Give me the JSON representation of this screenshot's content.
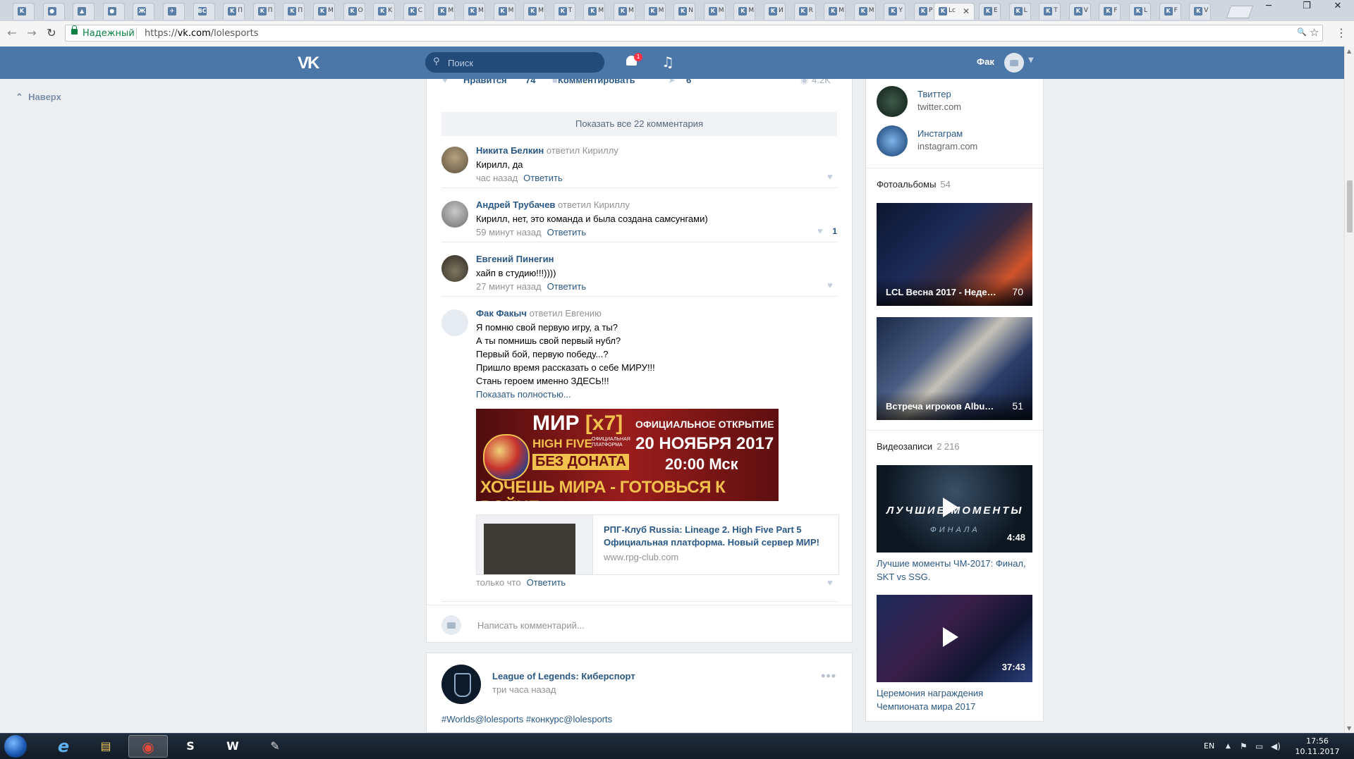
{
  "browser": {
    "tabs": [
      {
        "glyph": "K"
      },
      {
        "glyph": "●"
      },
      {
        "glyph": "▲"
      },
      {
        "glyph": "●"
      },
      {
        "glyph": "Ж"
      },
      {
        "glyph": "✈"
      },
      {
        "glyph": "BC"
      },
      {
        "glyph": "K",
        "label": "П"
      },
      {
        "glyph": "K",
        "label": "П"
      },
      {
        "glyph": "K",
        "label": "П"
      },
      {
        "glyph": "K",
        "label": "M"
      },
      {
        "glyph": "K",
        "label": "О"
      },
      {
        "glyph": "K",
        "label": "K"
      },
      {
        "glyph": "K",
        "label": "C"
      },
      {
        "glyph": "K",
        "label": "M"
      },
      {
        "glyph": "K",
        "label": "M"
      },
      {
        "glyph": "K",
        "label": "M"
      },
      {
        "glyph": "K",
        "label": "M"
      },
      {
        "glyph": "K",
        "label": "T"
      },
      {
        "glyph": "K",
        "label": "M"
      },
      {
        "glyph": "K",
        "label": "M"
      },
      {
        "glyph": "K",
        "label": "M"
      },
      {
        "glyph": "K",
        "label": "N"
      },
      {
        "glyph": "K",
        "label": "M"
      },
      {
        "glyph": "K",
        "label": "M"
      },
      {
        "glyph": "K",
        "label": "И"
      },
      {
        "glyph": "K",
        "label": "R"
      },
      {
        "glyph": "K",
        "label": "M"
      },
      {
        "glyph": "K",
        "label": "M"
      },
      {
        "glyph": "K",
        "label": "Y"
      },
      {
        "glyph": "K",
        "label": "P"
      }
    ],
    "active_tab": {
      "glyph": "K",
      "label": "Lc",
      "close": "✕"
    },
    "tabs_after": [
      {
        "glyph": "K",
        "label": "E"
      },
      {
        "glyph": "K",
        "label": "L"
      },
      {
        "glyph": "K",
        "label": "T"
      },
      {
        "glyph": "K",
        "label": "V"
      },
      {
        "glyph": "K",
        "label": "F"
      },
      {
        "glyph": "K",
        "label": "L"
      },
      {
        "glyph": "K",
        "label": "F"
      },
      {
        "glyph": "K",
        "label": "V"
      }
    ],
    "window_controls": {
      "minimize": "─",
      "restore": "❐",
      "close": "✕"
    },
    "nav": {
      "back": "←",
      "forward": "→",
      "reload": "↻"
    },
    "secure_label": "Надежный",
    "url_scheme": "https://",
    "url_host": "vk.com",
    "url_path": "/lolesports",
    "zoom_icon": "🔍",
    "star_icon": "☆",
    "menu_icon": "⋮"
  },
  "header": {
    "logo": "VK",
    "search_placeholder": "Поиск",
    "notifications_count": "1",
    "user_name": "Фак"
  },
  "left": {
    "back_to_top": "Наверх"
  },
  "post": {
    "actions": {
      "like_label": "Нравится",
      "like_count": "74",
      "comment_label": "Комментировать",
      "share_count": "6",
      "views": "4.2K"
    },
    "show_all_comments": "Показать все 22 комментария",
    "comments": [
      {
        "author": "Никита Белкин",
        "reply_to": "ответил Кириллу",
        "text": [
          "Кирилл, да"
        ],
        "time": "час назад",
        "reply": "Ответить",
        "likes": ""
      },
      {
        "author": "Андрей Трубачев",
        "reply_to": "ответил Кириллу",
        "text": [
          "Кирилл, нет, это команда и была создана самсунгами)"
        ],
        "time": "59 минут назад",
        "reply": "Ответить",
        "likes": "1"
      },
      {
        "author": "Евгений Пинегин",
        "reply_to": "",
        "text": [
          "хайп в студию!!!))))"
        ],
        "time": "27 минут назад",
        "reply": "Ответить",
        "likes": ""
      },
      {
        "author": "Фак Факыч",
        "reply_to": "ответил Евгению",
        "text": [
          "Я помню свой первую игру, а ты?",
          "А ты помнишь свой первый нубл?",
          "Первый бой, первую победу...?",
          "Пришло время рассказать о себе МИРУ!!!",
          "Стань героем именно ЗДЕСЬ!!!"
        ],
        "show_more": "Показать полностью...",
        "time": "только что",
        "reply": "Ответить",
        "likes": ""
      }
    ],
    "banner": {
      "line1": "МИР",
      "line1b": "[x7]",
      "line2": "ОФИЦИАЛЬНОЕ ОТКРЫТИЕ",
      "line3": "HIGH FIVE",
      "line3s": "ОФИЦИАЛЬНАЯ ПЛАТФОРМА",
      "line4": "20 НОЯБРЯ 2017",
      "line5": "БЕЗ ДОНАТА",
      "line6": "20:00 Мск",
      "line7": "ХОЧЕШЬ МИРА - ГОТОВЬСЯ К ВОЙНЕ"
    },
    "link": {
      "title": "РПГ-Клуб Russia: Lineage 2. High Five Part 5 Официальная платформа. Новый сервер МИР!",
      "domain": "www.rpg-club.com"
    },
    "write_placeholder": "Написать комментарий..."
  },
  "next_post": {
    "group": "League of Legends: Киберспорт",
    "time": "три часа назад",
    "tags": "#Worlds@lolesports #конкурс@lolesports",
    "menu": "•••"
  },
  "right": {
    "links": [
      {
        "name": "Твиттер",
        "domain": "twitter.com"
      },
      {
        "name": "Инстаграм",
        "domain": "instagram.com"
      }
    ],
    "albums_label": "Фотоальбомы",
    "albums_count": "54",
    "albums": [
      {
        "title": "LCL Весна 2017 - Недел...",
        "count": "70"
      },
      {
        "title": "Встреча игроков Albus N...",
        "count": "51"
      }
    ],
    "videos_label": "Видеозаписи",
    "videos_count": "2 216",
    "videos": [
      {
        "title": "Лучшие моменты ЧМ-2017: Финал, SKT vs SSG.",
        "duration": "4:48",
        "overlay1": "ЛУЧШИЕ МОМЕНТЫ",
        "overlay2": "ФИНАЛА"
      },
      {
        "title": "Церемония награждения Чемпионата мира 2017",
        "duration": "37:43"
      }
    ]
  },
  "taskbar": {
    "apps": [
      {
        "name": "ie",
        "glyph": "e"
      },
      {
        "name": "explorer",
        "glyph": "▤"
      },
      {
        "name": "chrome",
        "glyph": "◉"
      },
      {
        "name": "skype",
        "glyph": "S"
      },
      {
        "name": "word",
        "glyph": "W"
      },
      {
        "name": "paint",
        "glyph": "✎"
      }
    ],
    "lang": "EN",
    "tray_up": "▲",
    "tray_flag": "⚑",
    "tray_net": "▭",
    "tray_vol": "◀)",
    "time": "17:56",
    "date": "10.11.2017"
  },
  "colors": {
    "vk_blue": "#4a76a8",
    "link": "#2a5885",
    "page_bg": "#edeef0"
  }
}
